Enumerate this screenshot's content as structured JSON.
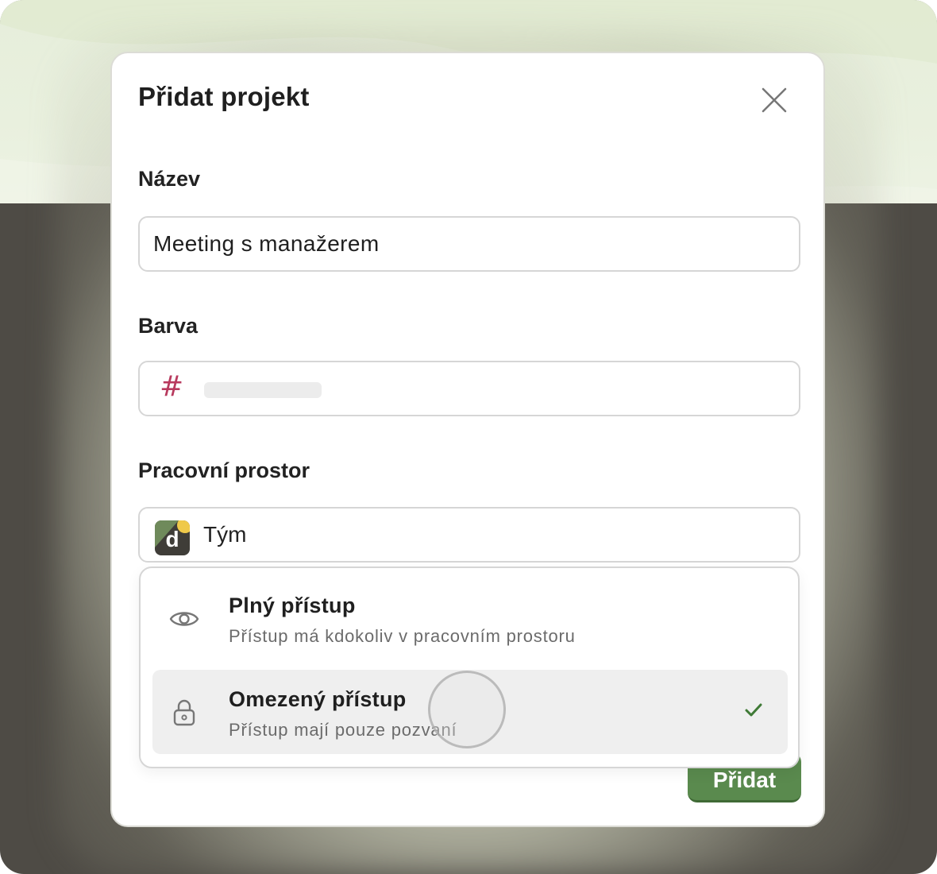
{
  "dialog": {
    "title": "Přidat projekt",
    "close_icon": "close-icon"
  },
  "name_field": {
    "label": "Název",
    "value": "Meeting s manažerem"
  },
  "color_field": {
    "label": "Barva",
    "prefix": "#",
    "value": "",
    "prefix_color": "#b83a5e"
  },
  "workspace_field": {
    "label": "Pracovní prostor",
    "value": "Tým",
    "logo_letter": "d"
  },
  "access_menu": {
    "options": [
      {
        "title": "Plný přístup",
        "subtitle": "Přístup má kdokoliv v pracovním prostoru",
        "icon": "eye-icon",
        "selected": false
      },
      {
        "title": "Omezený přístup",
        "subtitle": "Přístup mají pouze pozvaní",
        "icon": "lock-icon",
        "selected": true
      }
    ],
    "selected_icon": "checkmark-icon"
  },
  "actions": {
    "add_label": "Přidat",
    "accent": "#5a8a4e"
  }
}
